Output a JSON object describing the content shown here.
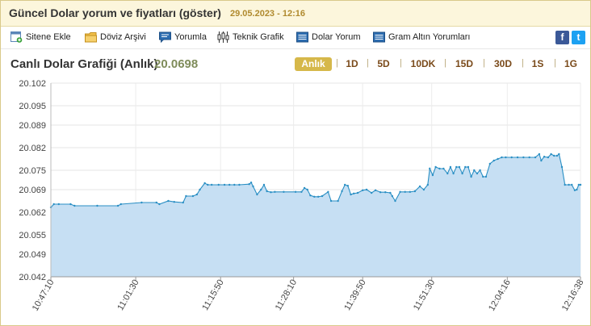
{
  "header": {
    "title": "Güncel Dolar yorum ve fiyatları (göster)",
    "datetime": "29.05.2023 - 12:16"
  },
  "toolbar": {
    "items": [
      {
        "label": "Sitene Ekle",
        "icon": "add-site-icon"
      },
      {
        "label": "Döviz Arşivi",
        "icon": "folder-icon"
      },
      {
        "label": "Yorumla",
        "icon": "comment-icon"
      },
      {
        "label": "Teknik Grafik",
        "icon": "candlestick-icon"
      },
      {
        "label": "Dolar Yorum",
        "icon": "list-icon"
      },
      {
        "label": "Gram Altın Yorumları",
        "icon": "list-icon"
      }
    ],
    "social": [
      {
        "name": "facebook-icon",
        "glyph": "f",
        "color": "#3b5998"
      },
      {
        "name": "twitter-icon",
        "glyph": "t",
        "color": "#1da1f2"
      }
    ]
  },
  "chart_header": {
    "title": "Canlı Dolar Grafiği (Anlık)",
    "value": "20.0698",
    "ranges": [
      "Anlık",
      "1D",
      "5D",
      "10DK",
      "15D",
      "30D",
      "1S",
      "1G"
    ],
    "active_range": "Anlık"
  },
  "chart_data": {
    "type": "area",
    "line_color": "#2a8fc4",
    "fill_color": "#c6dff3",
    "grid": true,
    "y_ticks": [
      "20.102",
      "20.095",
      "20.089",
      "20.082",
      "20.075",
      "20.069",
      "20.062",
      "20.055",
      "20.049",
      "20.042"
    ],
    "ylim": [
      20.042,
      20.102
    ],
    "x_ticks": [
      "10:47:10",
      "11:01:30",
      "11:15:50",
      "11:28:10",
      "11:39:50",
      "11:51:30",
      "12:04:16",
      "12:16:38"
    ],
    "x_time_range": [
      "10:47:10",
      "12:16:38"
    ],
    "series": [
      {
        "points": [
          [
            "10:47:10",
            20.0635
          ],
          [
            "10:47:40",
            20.0645
          ],
          [
            "10:48:30",
            20.0645
          ],
          [
            "10:50:30",
            20.0645
          ],
          [
            "10:51:10",
            20.064
          ],
          [
            "10:55:00",
            20.064
          ],
          [
            "10:58:30",
            20.064
          ],
          [
            "10:59:00",
            20.0645
          ],
          [
            "11:02:30",
            20.065
          ],
          [
            "11:05:00",
            20.065
          ],
          [
            "11:05:30",
            20.0645
          ],
          [
            "11:07:00",
            20.0655
          ],
          [
            "11:08:00",
            20.0652
          ],
          [
            "11:09:30",
            20.065
          ],
          [
            "11:10:00",
            20.067
          ],
          [
            "11:11:10",
            20.067
          ],
          [
            "11:11:50",
            20.0675
          ],
          [
            "11:12:20",
            20.069
          ],
          [
            "11:13:10",
            20.071
          ],
          [
            "11:13:40",
            20.0705
          ],
          [
            "11:14:20",
            20.0705
          ],
          [
            "11:15:30",
            20.0705
          ],
          [
            "11:16:30",
            20.0705
          ],
          [
            "11:17:20",
            20.0705
          ],
          [
            "11:18:10",
            20.0705
          ],
          [
            "11:19:00",
            20.0705
          ],
          [
            "11:20:40",
            20.0707
          ],
          [
            "11:21:00",
            20.0712
          ],
          [
            "11:21:20",
            20.07
          ],
          [
            "11:22:00",
            20.0675
          ],
          [
            "11:22:40",
            20.069
          ],
          [
            "11:23:10",
            20.0705
          ],
          [
            "11:23:40",
            20.0685
          ],
          [
            "11:24:20",
            20.0682
          ],
          [
            "11:25:00",
            20.0683
          ],
          [
            "11:26:30",
            20.0683
          ],
          [
            "11:28:30",
            20.0683
          ],
          [
            "11:29:30",
            20.0683
          ],
          [
            "11:30:00",
            20.0695
          ],
          [
            "11:30:30",
            20.069
          ],
          [
            "11:31:00",
            20.0672
          ],
          [
            "11:31:40",
            20.0668
          ],
          [
            "11:32:20",
            20.0668
          ],
          [
            "11:33:00",
            20.067
          ],
          [
            "11:34:00",
            20.0683
          ],
          [
            "11:34:30",
            20.0655
          ],
          [
            "11:35:40",
            20.0655
          ],
          [
            "11:36:20",
            20.0685
          ],
          [
            "11:36:50",
            20.0705
          ],
          [
            "11:37:20",
            20.0702
          ],
          [
            "11:37:50",
            20.0675
          ],
          [
            "11:38:20",
            20.0678
          ],
          [
            "11:39:00",
            20.068
          ],
          [
            "11:39:50",
            20.0688
          ],
          [
            "11:40:30",
            20.069
          ],
          [
            "11:41:20",
            20.068
          ],
          [
            "11:42:00",
            20.0688
          ],
          [
            "11:42:50",
            20.0682
          ],
          [
            "11:43:40",
            20.0682
          ],
          [
            "11:44:30",
            20.068
          ],
          [
            "11:44:50",
            20.067
          ],
          [
            "11:45:20",
            20.0655
          ],
          [
            "11:46:10",
            20.0683
          ],
          [
            "11:47:00",
            20.0683
          ],
          [
            "11:47:50",
            20.0683
          ],
          [
            "11:48:40",
            20.0685
          ],
          [
            "11:49:30",
            20.07
          ],
          [
            "11:50:10",
            20.069
          ],
          [
            "11:50:50",
            20.0705
          ],
          [
            "11:51:10",
            20.0755
          ],
          [
            "11:51:40",
            20.0735
          ],
          [
            "11:52:10",
            20.076
          ],
          [
            "11:52:50",
            20.0755
          ],
          [
            "11:53:30",
            20.0755
          ],
          [
            "11:54:10",
            20.074
          ],
          [
            "11:54:40",
            20.076
          ],
          [
            "11:55:10",
            20.074
          ],
          [
            "11:55:40",
            20.076
          ],
          [
            "11:56:10",
            20.076
          ],
          [
            "11:56:40",
            20.074
          ],
          [
            "11:57:10",
            20.076
          ],
          [
            "11:57:40",
            20.076
          ],
          [
            "11:58:10",
            20.073
          ],
          [
            "11:58:40",
            20.075
          ],
          [
            "11:59:10",
            20.074
          ],
          [
            "11:59:40",
            20.075
          ],
          [
            "12:00:10",
            20.073
          ],
          [
            "12:00:40",
            20.073
          ],
          [
            "12:01:20",
            20.077
          ],
          [
            "12:02:00",
            20.078
          ],
          [
            "12:02:40",
            20.0785
          ],
          [
            "12:03:20",
            20.079
          ],
          [
            "12:04:00",
            20.079
          ],
          [
            "12:05:00",
            20.079
          ],
          [
            "12:06:00",
            20.079
          ],
          [
            "12:07:00",
            20.079
          ],
          [
            "12:08:00",
            20.079
          ],
          [
            "12:09:00",
            20.079
          ],
          [
            "12:09:40",
            20.08
          ],
          [
            "12:10:00",
            20.078
          ],
          [
            "12:10:30",
            20.0792
          ],
          [
            "12:11:10",
            20.079
          ],
          [
            "12:11:40",
            20.08
          ],
          [
            "12:12:10",
            20.0795
          ],
          [
            "12:12:40",
            20.0795
          ],
          [
            "12:13:00",
            20.08
          ],
          [
            "12:13:30",
            20.076
          ],
          [
            "12:14:00",
            20.0705
          ],
          [
            "12:14:40",
            20.0705
          ],
          [
            "12:15:10",
            20.0705
          ],
          [
            "12:15:40",
            20.0688
          ],
          [
            "12:16:00",
            20.069
          ],
          [
            "12:16:20",
            20.0705
          ],
          [
            "12:16:38",
            20.0705
          ]
        ]
      }
    ]
  }
}
